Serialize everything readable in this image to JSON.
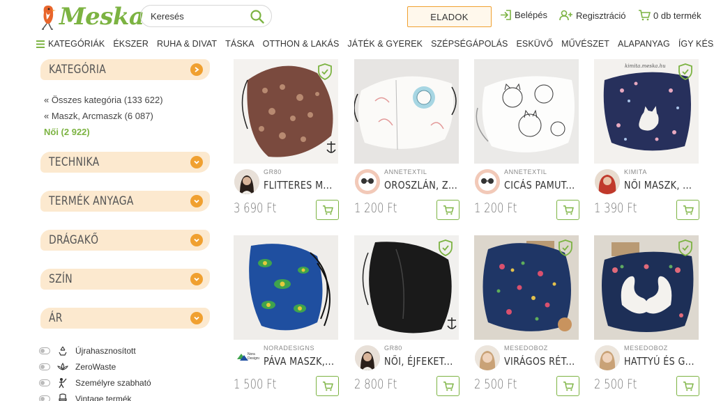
{
  "header": {
    "logo_text": "Meska",
    "search_placeholder": "Keresés",
    "sell_label": "ELADOK",
    "login_label": "Belépés",
    "register_label": "Regisztráció",
    "cart_label": "0 db termék"
  },
  "nav": {
    "categories_label": "KATEGÓRIÁK",
    "items": [
      "ÉKSZER",
      "RUHA & DIVAT",
      "TÁSKA",
      "OTTHON & LAKÁS",
      "JÁTÉK & GYEREK",
      "SZÉPSÉGÁPOLÁS",
      "ESKÜVŐ",
      "MŰVÉSZET",
      "ALAPANYAG",
      "ÍGY KÉSZÜLT"
    ]
  },
  "sidebar": {
    "filters": [
      "KATEGÓRIA",
      "TECHNIKA",
      "TERMÉK ANYAGA",
      "DRÁGAKŐ",
      "SZÍN",
      "ÁR"
    ],
    "categories": [
      "« Összes kategória (133 622)",
      "« Maszk, Arcmaszk (6 087)",
      "Női (2 922)"
    ],
    "toggles": [
      "Újrahasznosított",
      "ZeroWaste",
      "Személyre szabható",
      "Vintage termék"
    ]
  },
  "products": [
    {
      "seller": "GR80",
      "title": "FLITTERES M...",
      "price": "3 690 Ft"
    },
    {
      "seller": "ANNETEXTIL",
      "title": "OROSZLÁN, Z...",
      "price": "1 200 Ft"
    },
    {
      "seller": "ANNETEXTIL",
      "title": "CICÁS PAMUT...",
      "price": "1 200 Ft"
    },
    {
      "seller": "KIMITA",
      "title": "NŐI MASZK, ...",
      "price": "1 390 Ft"
    },
    {
      "seller": "NORADESIGNS",
      "title": "PÁVA MASZK,...",
      "price": "1 500 Ft"
    },
    {
      "seller": "GR80",
      "title": "NŐI, ÉJFEKET...",
      "price": "2 800 Ft"
    },
    {
      "seller": "MESEDOBOZ",
      "title": "VIRÁGOS RÉT...",
      "price": "2 500 Ft"
    },
    {
      "seller": "MESEDOBOZ",
      "title": "HATTYÚ ÉS G...",
      "price": "2 500 Ft"
    }
  ],
  "image_text": {
    "p4_watermark": "kimita.meska.hu",
    "p5_brand": "Nora Designs"
  },
  "colors": {
    "brand_green": "#7cb342",
    "accent_orange": "#f0a030",
    "filter_bg": "#fce9cf"
  }
}
